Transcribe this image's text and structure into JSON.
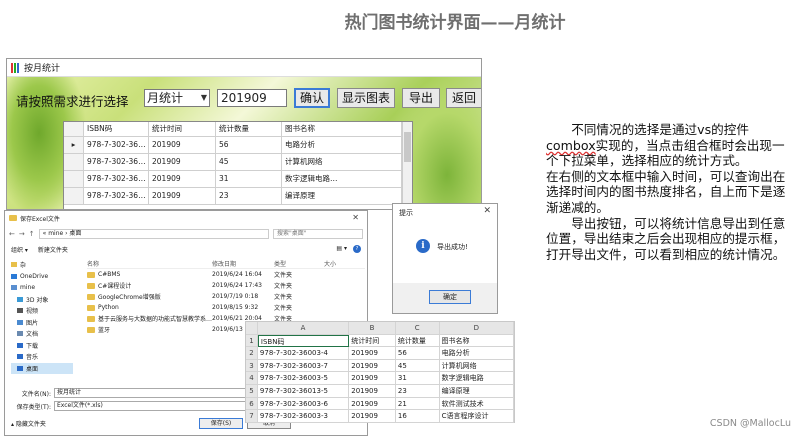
{
  "slide": {
    "title": "热门图书统计界面——月统计",
    "watermark": "CSDN @MallocLu"
  },
  "main_window": {
    "title": "按月统计",
    "prompt": "请按照需求进行选择",
    "combo_value": "月统计",
    "date_value": "201909",
    "confirm_label": "确认",
    "show_chart_label": "显示图表",
    "export_label": "导出",
    "back_label": "返回",
    "columns": [
      "ISBN码",
      "统计时间",
      "统计数量",
      "图书名称"
    ],
    "rows": [
      [
        "978-7-302-36…",
        "201909",
        "56",
        "电路分析"
      ],
      [
        "978-7-302-36…",
        "201909",
        "45",
        "计算机网络"
      ],
      [
        "978-7-302-36…",
        "201909",
        "31",
        "数字逻辑电路…"
      ],
      [
        "978-7-302-36…",
        "201909",
        "23",
        "编译原理"
      ]
    ],
    "row_marker": "▸"
  },
  "save_dialog": {
    "title": "保存Excel文件",
    "close": "✕",
    "address": "«  mine  ›  桌面",
    "search_placeholder": "搜索\"桌面\"",
    "organize": "组织 ▾",
    "new_folder": "新建文件夹",
    "help": "?",
    "view_icons": "▤ ▾",
    "nav": [
      {
        "label": "杂",
        "color": "#e8c04a"
      },
      {
        "label": "OneDrive",
        "color": "#2a7ad6"
      },
      {
        "label": "mine",
        "color": "#5a8fd0"
      },
      {
        "label": "3D 对象",
        "color": "#3a9ad6"
      },
      {
        "label": "视频",
        "color": "#555555"
      },
      {
        "label": "图片",
        "color": "#4a8ad0"
      },
      {
        "label": "文档",
        "color": "#6a8ab0"
      },
      {
        "label": "下载",
        "color": "#2a6ac8"
      },
      {
        "label": "音乐",
        "color": "#2a6ac8"
      },
      {
        "label": "桌面",
        "color": "#2a6ac8"
      }
    ],
    "file_headers": [
      "名称",
      "修改日期",
      "类型",
      "大小"
    ],
    "files": [
      {
        "name": "C#BMS",
        "date": "2019/6/24 16:04",
        "type": "文件夹",
        "size": ""
      },
      {
        "name": "C#课程设计",
        "date": "2019/6/24 17:43",
        "type": "文件夹",
        "size": ""
      },
      {
        "name": "GoogleChrome增强版",
        "date": "2019/7/19 0:18",
        "type": "文件夹",
        "size": ""
      },
      {
        "name": "Python",
        "date": "2019/8/15 9:32",
        "type": "文件夹",
        "size": ""
      },
      {
        "name": "基于云服务与大数据的功能式智慧教学系…",
        "date": "2019/6/21 20:04",
        "type": "文件夹",
        "size": ""
      },
      {
        "name": "蓝牙",
        "date": "2019/6/13",
        "type": "文件夹",
        "size": ""
      }
    ],
    "filename_label": "文件名(N):",
    "filename_value": "按月统计",
    "filetype_label": "保存类型(T):",
    "filetype_value": "Excel文件(*.xls)",
    "hide_folders": "▴ 隐藏文件夹",
    "save_label": "保存(S)",
    "cancel_label": "取消"
  },
  "message_box": {
    "title": "提示",
    "close": "✕",
    "icon": "i",
    "text": "导出成功!",
    "ok_label": "确定"
  },
  "excel": {
    "col_letters": [
      "A",
      "B",
      "C",
      "D"
    ],
    "rows": [
      [
        "ISBN码",
        "统计时间",
        "统计数量",
        "图书名称"
      ],
      [
        "978-7-302-36003-4",
        "201909",
        "56",
        "电路分析"
      ],
      [
        "978-7-302-36003-7",
        "201909",
        "45",
        "计算机网络"
      ],
      [
        "978-7-302-36003-5",
        "201909",
        "31",
        "数字逻辑电路"
      ],
      [
        "978-7-302-36013-5",
        "201909",
        "23",
        "编译原理"
      ],
      [
        "978-7-302-36003-6",
        "201909",
        "21",
        "软件测试技术"
      ],
      [
        "978-7-302-36003-3",
        "201909",
        "16",
        "C语言程序设计"
      ]
    ]
  },
  "description": {
    "p1_indent": "不同情况的选择是通过vs的控件",
    "p1_wavy": "combox",
    "p1_rest": "实现的，当点击组合框时会出现一个下拉菜单，选择相应的统计方式。",
    "p2": "在右侧的文本框中输入时间，可以查询出在选择时间内的图书热度排名，自上而下是逐渐递减的。",
    "p3": "导出按钮，可以将统计信息导出到任意位置，导出结束之后会出现相应的提示框，打开导出文件，可以看到相应的统计情况。"
  }
}
